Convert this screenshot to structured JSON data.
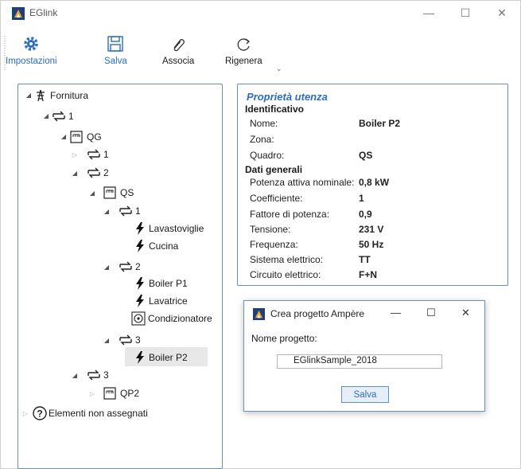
{
  "window": {
    "title": "EGlink",
    "minimize": "—",
    "maximize": "☐",
    "close": "✕"
  },
  "toolbar": {
    "items": [
      {
        "label": "Impostazioni",
        "icon": "gear-icon"
      },
      {
        "label": "Salva",
        "icon": "save-icon"
      },
      {
        "label": "Associa",
        "icon": "paperclip-icon"
      },
      {
        "label": "Rigenera",
        "icon": "refresh-icon"
      }
    ],
    "caret": "⌄",
    "accent": "#2b6cc4"
  },
  "tree": {
    "root": "Fornitura",
    "n1": "1",
    "qg": "QG",
    "qg_1": "1",
    "qg_2": "2",
    "qs": "QS",
    "qs_1": "1",
    "lavastoviglie": "Lavastoviglie",
    "cucina": "Cucina",
    "qs_2": "2",
    "boiler_p1": "Boiler P1",
    "lavatrice": "Lavatrice",
    "condizionatore": "Condizionatore",
    "qs_3": "3",
    "boiler_p2": "Boiler P2",
    "n3": "3",
    "qp2": "QP2",
    "unassigned": "Elementi non assegnati"
  },
  "properties": {
    "title": "Proprietà utenza",
    "section_id": "Identificativo",
    "nome_label": "Nome:",
    "nome_value": "Boiler P2",
    "zona_label": "Zona:",
    "zona_value": "",
    "quadro_label": "Quadro:",
    "quadro_value": "QS",
    "section_general": "Dati generali",
    "potenza_label": "Potenza attiva nominale:",
    "potenza_value": "0,8 kW",
    "coeff_label": "Coefficiente:",
    "coeff_value": "1",
    "fattore_label": "Fattore di potenza:",
    "fattore_value": "0,9",
    "tensione_label": "Tensione:",
    "tensione_value": "231 V",
    "frequenza_label": "Frequenza:",
    "frequenza_value": "50 Hz",
    "sistema_label": "Sistema elettrico:",
    "sistema_value": "TT",
    "circuito_label": "Circuito elettrico:",
    "circuito_value": "F+N"
  },
  "dialog": {
    "title": "Crea progetto Ampère",
    "minimize": "—",
    "maximize": "☐",
    "close": "✕",
    "name_label": "Nome progetto:",
    "name_value": "EGlinkSample_2018",
    "save_label": "Salva"
  }
}
